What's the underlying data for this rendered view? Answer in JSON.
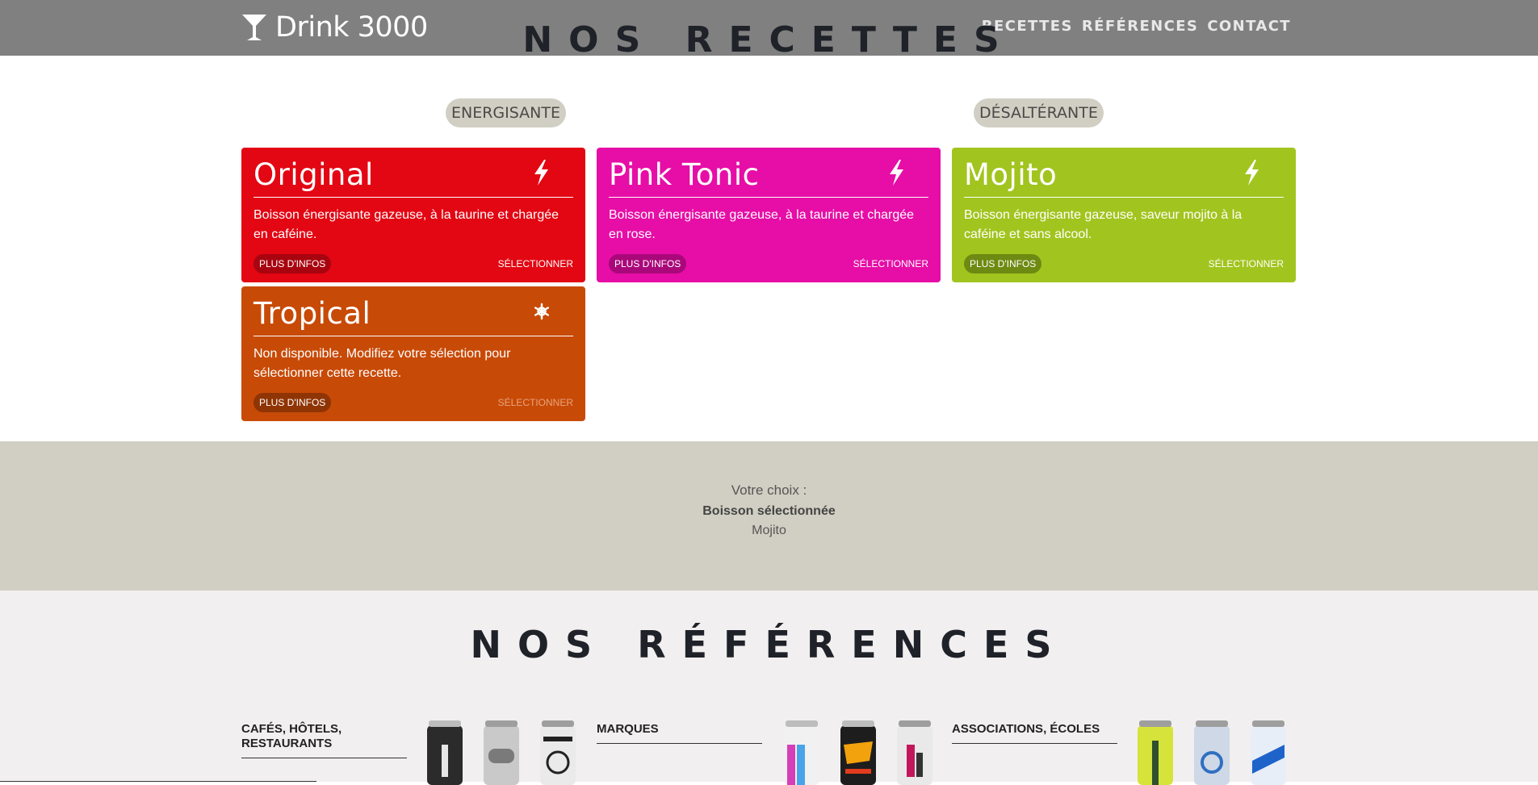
{
  "nav": {
    "brand": "Drink 3000",
    "brand_icon": "cocktail-glass-icon",
    "links": [
      "RECETTES",
      "RÉFÉRENCES",
      "CONTACT"
    ]
  },
  "recettes": {
    "title": "NOS RECETTES",
    "filters": [
      "ENERGISANTE",
      "DÉSALTÉRANTE"
    ],
    "cards": [
      {
        "name": "Original",
        "icon": "lightning-icon",
        "desc": "Boisson énergisante gazeuse, à la taurine et chargée en caféine.",
        "more": "PLUS D'INFOS",
        "select": "SÉLECTIONNER",
        "color": "#e30613"
      },
      {
        "name": "Pink Tonic",
        "icon": "lightning-icon",
        "desc": "Boisson énergisante gazeuse, à la taurine et chargée en rose.",
        "more": "PLUS D'INFOS",
        "select": "SÉLECTIONNER",
        "color": "#e60ea6"
      },
      {
        "name": "Mojito",
        "icon": "lightning-icon",
        "desc": "Boisson énergisante gazeuse, saveur mojito à la caféine et sans alcool.",
        "more": "PLUS D'INFOS",
        "select": "SÉLECTIONNER",
        "color": "#a2c41f"
      },
      {
        "name": "Tropical",
        "icon": "snowflake-icon",
        "desc": "Non disponible. Modifiez votre sélection pour sélectionner cette recette.",
        "more": "PLUS D'INFOS",
        "select": "SÉLECTIONNER",
        "color": "#c84a07",
        "disabled": true
      }
    ]
  },
  "choice": {
    "label": "Votre choix :",
    "selected_label": "Boisson sélectionnée",
    "selected_value": "Mojito"
  },
  "references": {
    "title": "NOS RÉFÉRENCES",
    "categories": [
      {
        "name": "CAFÉS, HÔTELS, RESTAURANTS"
      },
      {
        "name": "MARQUES"
      },
      {
        "name": "ASSOCIATIONS, ÉCOLES"
      }
    ]
  },
  "colors": {
    "navbar": "#808080",
    "filter_bg": "#d1cfc3",
    "refs_bg": "#f1eff0"
  }
}
